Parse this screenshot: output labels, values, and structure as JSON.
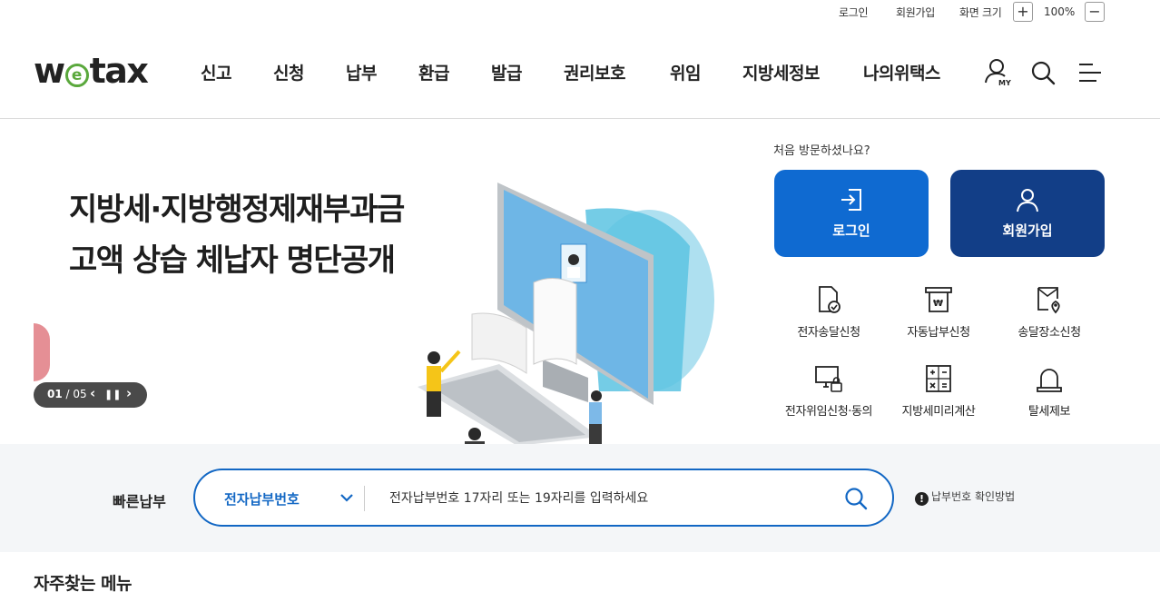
{
  "util": {
    "login": "로그인",
    "signup": "회원가입",
    "screen_size": "화면 크기",
    "zoom_in": "+",
    "zoom": "100%",
    "zoom_out": "−"
  },
  "header": {
    "logo": {
      "pre": "w",
      "e": "e",
      "post": "tax"
    },
    "nav": [
      "신고",
      "신청",
      "납부",
      "환급",
      "발급",
      "권리보호",
      "위임",
      "지방세정보",
      "나의위택스"
    ],
    "my_label": "MY"
  },
  "hero": {
    "title_line1": "지방세·지방행정제재부과금",
    "title_line2": "고액 상습 체납자 명단공개",
    "pager_current": "01",
    "pager_sep": " / ",
    "pager_total": "05",
    "prev": "‹",
    "pause": "❚❚",
    "next": "›"
  },
  "side": {
    "visit_question": "처음 방문하셨나요?",
    "login_button": "로그인",
    "join_button": "회원가입",
    "quick_menus": [
      {
        "label": "전자송달신청",
        "icon": "document-check-icon"
      },
      {
        "label": "자동납부신청",
        "icon": "won-receipt-icon"
      },
      {
        "label": "송달장소신청",
        "icon": "location-document-icon"
      },
      {
        "label": "전자위임신청·동의",
        "icon": "monitor-lock-icon"
      },
      {
        "label": "지방세미리계산",
        "icon": "calculator-icon"
      },
      {
        "label": "탈세제보",
        "icon": "alarm-bell-icon"
      }
    ]
  },
  "quickpay": {
    "label": "빠른납부",
    "select_value": "전자납부번호",
    "input_placeholder": "전자납부번호 17자리 또는 19자리를 입력하세요",
    "help_text": "납부번호 확인방법",
    "help_icon": "!"
  },
  "frequent_menu_title": "자주찾는 메뉴",
  "colors": {
    "primary_blue": "#0f6ad1",
    "navy": "#123e87",
    "logo_green": "#5aa83c",
    "search_border": "#1267c4"
  }
}
